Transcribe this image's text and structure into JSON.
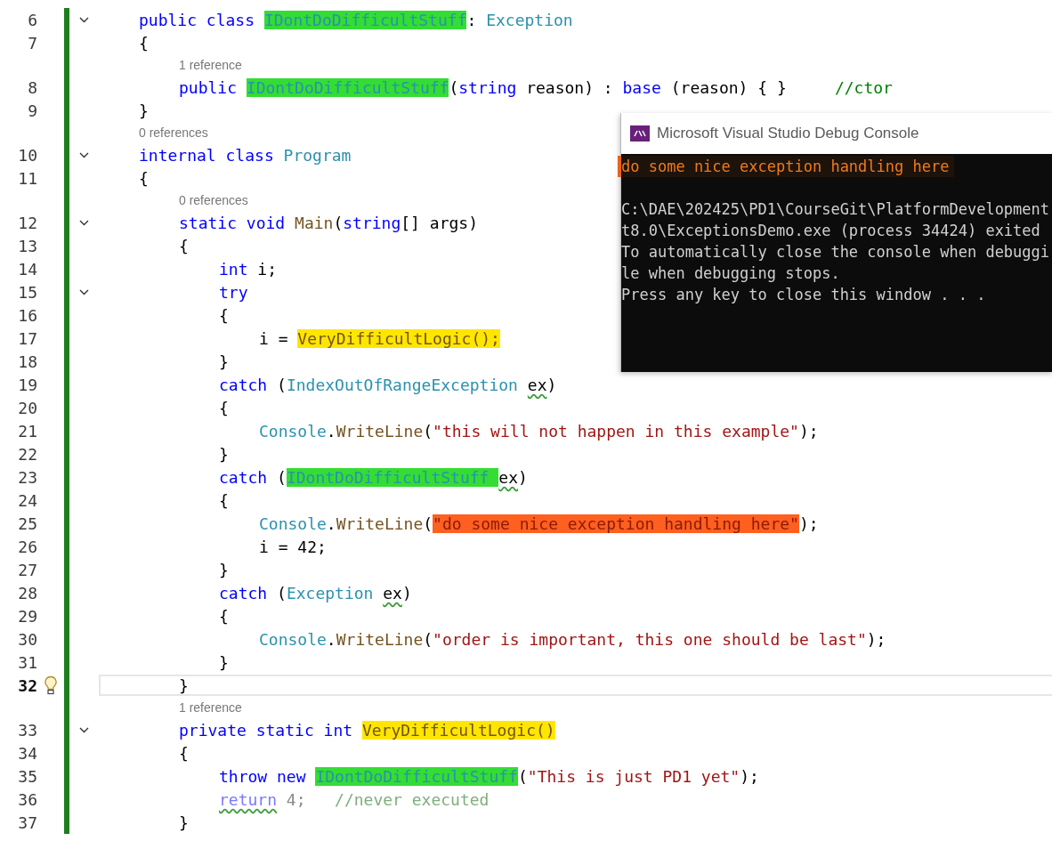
{
  "editor": {
    "lines": [
      {
        "kind": "code",
        "number": "6",
        "fold": true,
        "current": false,
        "tokens": [
          {
            "kind": "kw",
            "text": "public class "
          },
          {
            "kind": "type",
            "text": "IDontDoDifficultStuff",
            "color": "#33dd33"
          },
          {
            "kind": "plain",
            "text": ": "
          },
          {
            "kind": "type",
            "text": "Exception"
          }
        ]
      },
      {
        "kind": "code",
        "number": "7",
        "fold": false,
        "current": false,
        "tokens": [
          {
            "kind": "plain",
            "text": "{"
          }
        ]
      },
      {
        "kind": "lens",
        "text": "1 reference"
      },
      {
        "kind": "code",
        "number": "8",
        "fold": false,
        "current": false,
        "tokens": [
          {
            "kind": "kw",
            "text": "public "
          },
          {
            "kind": "type",
            "text": "IDontDoDifficultStuff",
            "color": "#33dd33"
          },
          {
            "kind": "plain",
            "text": "("
          },
          {
            "kind": "kw",
            "text": "string "
          },
          {
            "kind": "plain",
            "text": "reason) : "
          },
          {
            "kind": "kw",
            "text": "base "
          },
          {
            "kind": "plain",
            "text": "(reason) { }     "
          },
          {
            "kind": "com",
            "text": "//ctor"
          }
        ]
      },
      {
        "kind": "code",
        "number": "9",
        "fold": false,
        "current": false,
        "tokens": [
          {
            "kind": "plain",
            "text": "}"
          }
        ]
      },
      {
        "kind": "lens",
        "text": "0 references"
      },
      {
        "kind": "code",
        "number": "10",
        "fold": true,
        "current": false,
        "tokens": [
          {
            "kind": "kw",
            "text": "internal class "
          },
          {
            "kind": "type",
            "text": "Program"
          }
        ]
      },
      {
        "kind": "code",
        "number": "11",
        "fold": false,
        "current": false,
        "tokens": [
          {
            "kind": "plain",
            "text": "{"
          }
        ]
      },
      {
        "kind": "lens",
        "text": "0 references"
      },
      {
        "kind": "code",
        "number": "12",
        "fold": true,
        "current": false,
        "tokens": [
          {
            "kind": "kw",
            "text": "static void "
          },
          {
            "kind": "method",
            "text": "Main"
          },
          {
            "kind": "plain",
            "text": "("
          },
          {
            "kind": "kw",
            "text": "string"
          },
          {
            "kind": "plain",
            "text": "[] args)"
          }
        ]
      },
      {
        "kind": "code",
        "number": "13",
        "fold": false,
        "current": false,
        "tokens": [
          {
            "kind": "plain",
            "text": "{"
          }
        ]
      },
      {
        "kind": "code",
        "number": "14",
        "fold": false,
        "current": false,
        "tokens": [
          {
            "kind": "kw",
            "text": "int "
          },
          {
            "kind": "plain",
            "text": "i;"
          }
        ]
      },
      {
        "kind": "code",
        "number": "15",
        "fold": true,
        "current": false,
        "tokens": [
          {
            "kind": "kw",
            "text": "try"
          }
        ]
      },
      {
        "kind": "code",
        "number": "16",
        "fold": false,
        "current": false,
        "tokens": [
          {
            "kind": "plain",
            "text": "{"
          }
        ]
      },
      {
        "kind": "code",
        "number": "17",
        "fold": false,
        "current": false,
        "tokens": [
          {
            "kind": "plain",
            "text": "i = "
          },
          {
            "kind": "method",
            "text": "VeryDifficultLogic();",
            "color": "#ffe600"
          }
        ]
      },
      {
        "kind": "code",
        "number": "18",
        "fold": false,
        "current": false,
        "tokens": [
          {
            "kind": "plain",
            "text": "}"
          }
        ]
      },
      {
        "kind": "code",
        "number": "19",
        "fold": false,
        "current": false,
        "tokens": [
          {
            "kind": "kw",
            "text": "catch "
          },
          {
            "kind": "plain",
            "text": "("
          },
          {
            "kind": "type",
            "text": "IndexOutOfRangeException "
          },
          {
            "kind": "plain",
            "text": "ex",
            "squiggle": true
          },
          {
            "kind": "plain",
            "text": ")"
          }
        ]
      },
      {
        "kind": "code",
        "number": "20",
        "fold": false,
        "current": false,
        "tokens": [
          {
            "kind": "plain",
            "text": "{"
          }
        ]
      },
      {
        "kind": "code",
        "number": "21",
        "fold": false,
        "current": false,
        "tokens": [
          {
            "kind": "type",
            "text": "Console"
          },
          {
            "kind": "plain",
            "text": "."
          },
          {
            "kind": "method",
            "text": "WriteLine"
          },
          {
            "kind": "plain",
            "text": "("
          },
          {
            "kind": "str",
            "text": "\"this will not happen in this example\""
          },
          {
            "kind": "plain",
            "text": ");"
          }
        ]
      },
      {
        "kind": "code",
        "number": "22",
        "fold": false,
        "current": false,
        "tokens": [
          {
            "kind": "plain",
            "text": "}"
          }
        ]
      },
      {
        "kind": "code",
        "number": "23",
        "fold": false,
        "current": false,
        "tokens": [
          {
            "kind": "kw",
            "text": "catch "
          },
          {
            "kind": "plain",
            "text": "("
          },
          {
            "kind": "type",
            "text": "IDontDoDifficultStuff ",
            "color": "#33dd33"
          },
          {
            "kind": "plain",
            "text": "ex",
            "squiggle": true
          },
          {
            "kind": "plain",
            "text": ")"
          }
        ]
      },
      {
        "kind": "code",
        "number": "24",
        "fold": false,
        "current": false,
        "tokens": [
          {
            "kind": "plain",
            "text": "{"
          }
        ]
      },
      {
        "kind": "code",
        "number": "25",
        "fold": false,
        "current": false,
        "tokens": [
          {
            "kind": "type",
            "text": "Console"
          },
          {
            "kind": "plain",
            "text": "."
          },
          {
            "kind": "method",
            "text": "WriteLine"
          },
          {
            "kind": "plain",
            "text": "("
          },
          {
            "kind": "str",
            "text": "\"do some nice exception handling here\"",
            "color": "#ff5f1f"
          },
          {
            "kind": "plain",
            "text": ");"
          }
        ]
      },
      {
        "kind": "code",
        "number": "26",
        "fold": false,
        "current": false,
        "tokens": [
          {
            "kind": "plain",
            "text": "i = 42;"
          }
        ]
      },
      {
        "kind": "code",
        "number": "27",
        "fold": false,
        "current": false,
        "tokens": [
          {
            "kind": "plain",
            "text": "}"
          }
        ]
      },
      {
        "kind": "code",
        "number": "28",
        "fold": false,
        "current": false,
        "tokens": [
          {
            "kind": "kw",
            "text": "catch "
          },
          {
            "kind": "plain",
            "text": "("
          },
          {
            "kind": "type",
            "text": "Exception "
          },
          {
            "kind": "plain",
            "text": "ex",
            "squiggle": true
          },
          {
            "kind": "plain",
            "text": ")"
          }
        ]
      },
      {
        "kind": "code",
        "number": "29",
        "fold": false,
        "current": false,
        "tokens": [
          {
            "kind": "plain",
            "text": "{"
          }
        ]
      },
      {
        "kind": "code",
        "number": "30",
        "fold": false,
        "current": false,
        "tokens": [
          {
            "kind": "type",
            "text": "Console"
          },
          {
            "kind": "plain",
            "text": "."
          },
          {
            "kind": "method",
            "text": "WriteLine"
          },
          {
            "kind": "plain",
            "text": "("
          },
          {
            "kind": "str",
            "text": "\"order is important, this one should be last\""
          },
          {
            "kind": "plain",
            "text": ");"
          }
        ]
      },
      {
        "kind": "code",
        "number": "31",
        "fold": false,
        "current": false,
        "tokens": [
          {
            "kind": "plain",
            "text": "}"
          }
        ]
      },
      {
        "kind": "code",
        "number": "32",
        "fold": false,
        "current": true,
        "tokens": [
          {
            "kind": "plain",
            "text": "}"
          }
        ]
      },
      {
        "kind": "lens",
        "text": "1 reference"
      },
      {
        "kind": "code",
        "number": "33",
        "fold": true,
        "current": false,
        "tokens": [
          {
            "kind": "kw",
            "text": "private static int "
          },
          {
            "kind": "method",
            "text": "VeryDifficultLogic()",
            "color": "#ffe600"
          }
        ]
      },
      {
        "kind": "code",
        "number": "34",
        "fold": false,
        "current": false,
        "tokens": [
          {
            "kind": "plain",
            "text": "{"
          }
        ]
      },
      {
        "kind": "code",
        "number": "35",
        "fold": false,
        "current": false,
        "tokens": [
          {
            "kind": "kw",
            "text": "throw new "
          },
          {
            "kind": "type",
            "text": "IDontDoDifficultStuff",
            "color": "#33dd33"
          },
          {
            "kind": "plain",
            "text": "("
          },
          {
            "kind": "str",
            "text": "\"This is just PD1 yet\""
          },
          {
            "kind": "plain",
            "text": ");"
          }
        ]
      },
      {
        "kind": "code",
        "number": "36",
        "fold": false,
        "current": false,
        "tokens": [
          {
            "kind": "kw-faded",
            "text": "return",
            "squiggle": true
          },
          {
            "kind": "plain-faded",
            "text": " 4;   "
          },
          {
            "kind": "com-faded",
            "text": "//never executed"
          }
        ]
      },
      {
        "kind": "code",
        "number": "37",
        "fold": false,
        "current": false,
        "tokens": [
          {
            "kind": "plain",
            "text": "}"
          }
        ]
      }
    ]
  },
  "console": {
    "title": "Microsoft Visual Studio Debug Console",
    "output": "do some nice exception handling here",
    "messages": [
      "C:\\DAE\\202425\\PD1\\CourseGit\\PlatformDevelopment",
      "t8.0\\ExceptionsDemo.exe (process 34424) exited",
      "To automatically close the console when debuggi",
      "le when debugging stops.",
      "Press any key to close this window . . ."
    ]
  }
}
